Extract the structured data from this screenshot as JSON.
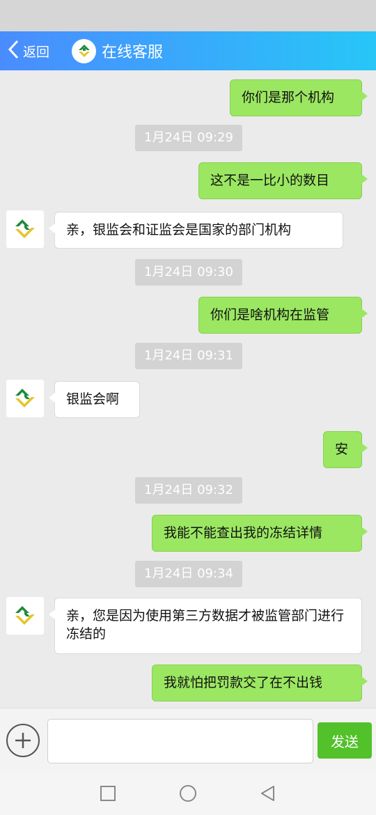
{
  "header": {
    "back_label": "返回",
    "title": "在线客服"
  },
  "messages": [
    {
      "side": "right",
      "text": "你们是那个机构"
    },
    {
      "side": "time",
      "text": "1月24日 09:29"
    },
    {
      "side": "right",
      "text": "这不是一比小的数目"
    },
    {
      "side": "left",
      "text": "亲，银监会和证监会是国家的部门机构"
    },
    {
      "side": "time",
      "text": "1月24日 09:30"
    },
    {
      "side": "right",
      "text": "你们是啥机构在监管"
    },
    {
      "side": "time",
      "text": "1月24日 09:31"
    },
    {
      "side": "left",
      "text": "银监会啊"
    },
    {
      "side": "right",
      "text": "安"
    },
    {
      "side": "time",
      "text": "1月24日 09:32"
    },
    {
      "side": "right",
      "text": "我能不能查出我的冻结详情"
    },
    {
      "side": "time",
      "text": "1月24日 09:34"
    },
    {
      "side": "left",
      "text": "亲，您是因为使用第三方数据才被监管部门进行冻结的"
    },
    {
      "side": "right",
      "text": "我就怕把罚款交了在不出钱"
    }
  ],
  "input": {
    "value": "",
    "send_label": "发送"
  },
  "colors": {
    "header_start": "#4a8cff",
    "header_end": "#27c6f7",
    "bubble_right": "#9be762",
    "send_button": "#52c12a"
  },
  "icons": {
    "back": "chevron-left-icon",
    "logo": "service-logo-icon",
    "plus": "plus-circle-icon",
    "nav_square": "square-icon",
    "nav_circle": "circle-icon",
    "nav_triangle": "triangle-back-icon"
  }
}
